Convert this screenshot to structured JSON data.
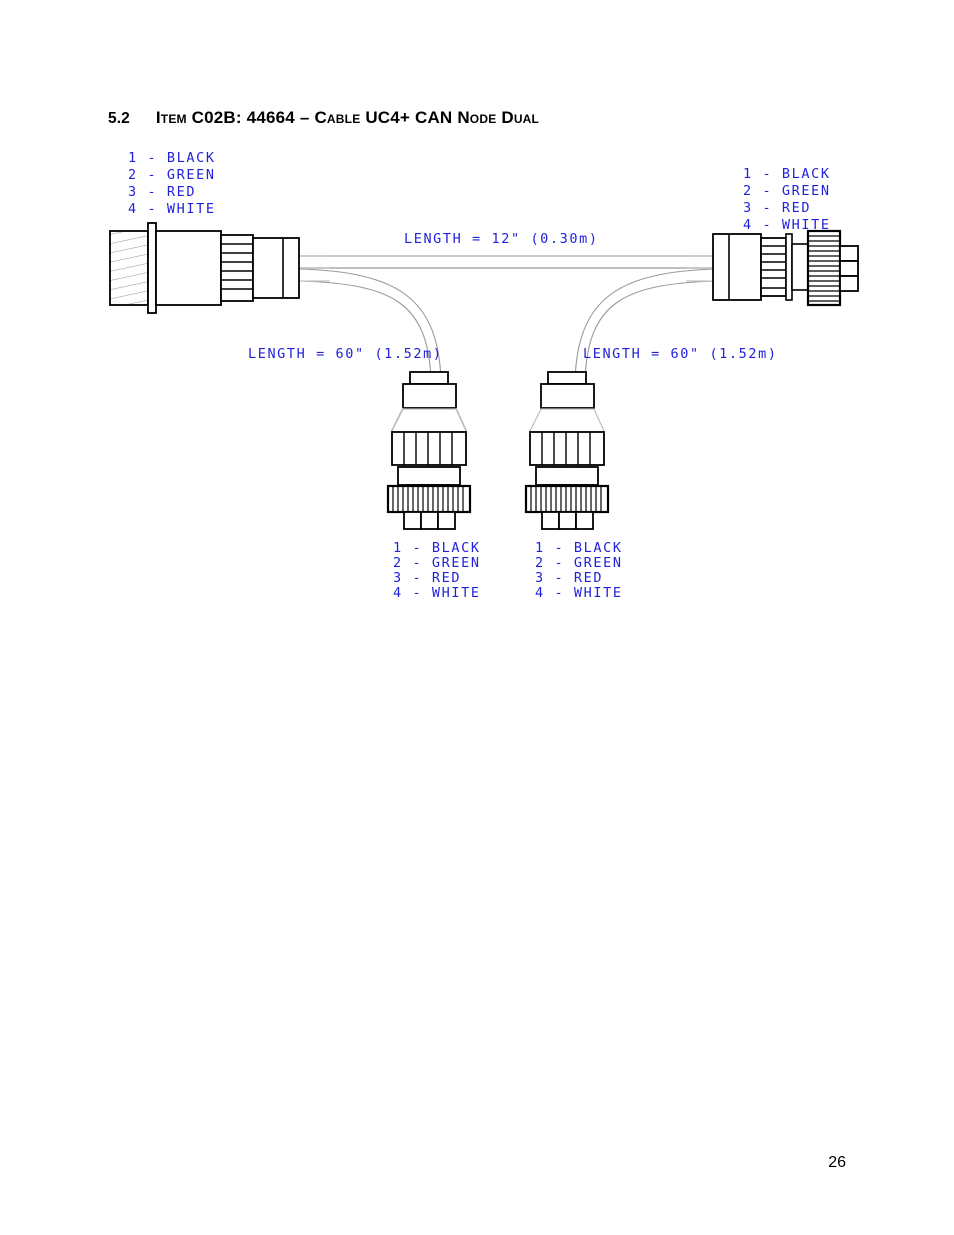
{
  "document": {
    "section_number": "5.2",
    "section_title": "Item C02B: 44664 – Cable UC4+ CAN Node Dual",
    "page_number": "26"
  },
  "diagram": {
    "title": "Cable UC4+ CAN Node Dual assembly drawing",
    "line_color": "#000000",
    "annotation_color": "#2222dd",
    "cable_color": "#888888",
    "labels": {
      "trunk_length": "LENGTH = 12\" (0.30m)",
      "branch_left_length": "LENGTH = 60\" (1.52m)",
      "branch_right_length": "LENGTH = 60\" (1.52m)"
    },
    "pinouts": {
      "top_left": [
        "1 - BLACK",
        "2 - GREEN",
        "3 - RED",
        "4 - WHITE"
      ],
      "top_right": [
        "1 - BLACK",
        "2 - GREEN",
        "3 - RED",
        "4 - WHITE"
      ],
      "bottom_left": [
        "1 - BLACK",
        "2 - GREEN",
        "3 - RED",
        "4 - WHITE"
      ],
      "bottom_right": [
        "1 - BLACK",
        "2 - GREEN",
        "3 - RED",
        "4 - WHITE"
      ]
    },
    "connectors": [
      {
        "id": "main-left",
        "orientation": "horizontal-left",
        "style": "bulkhead-receptacle"
      },
      {
        "id": "main-right",
        "orientation": "horizontal-right",
        "style": "knurled-plug"
      },
      {
        "id": "branch-left",
        "orientation": "vertical",
        "style": "knurled-plug"
      },
      {
        "id": "branch-right",
        "orientation": "vertical",
        "style": "knurled-plug"
      }
    ]
  }
}
